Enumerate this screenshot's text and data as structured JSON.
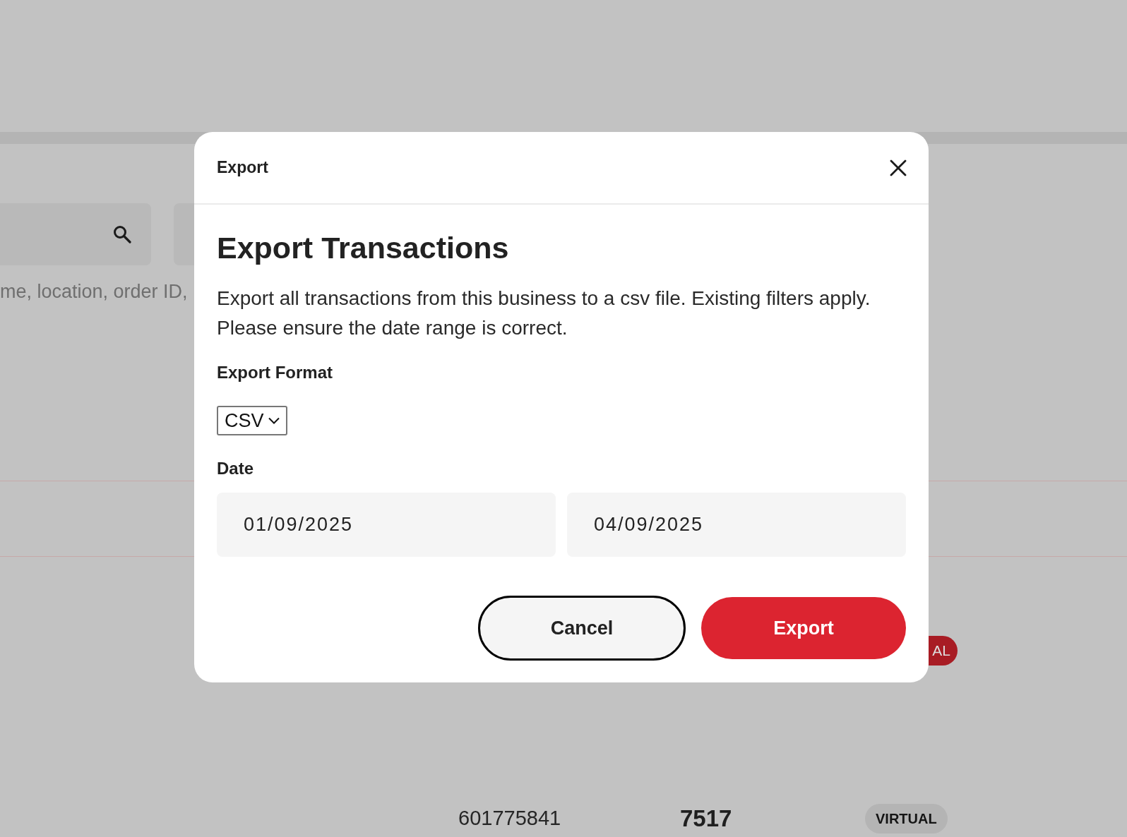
{
  "page": {
    "search_field": {
      "hint": "me, location, order ID,"
    },
    "badge": {
      "label": "AL"
    },
    "row": {
      "column_1": "601775841",
      "column_2": "7517",
      "badge": "VIRTUAL"
    }
  },
  "dialog": {
    "header_title": "Export",
    "title": "Export Transactions",
    "description": "Export all transactions from this business to a csv file. Existing filters apply. Please ensure the date range is correct.",
    "format": {
      "label": "Export Format",
      "value": "CSV"
    },
    "date": {
      "label": "Date",
      "start": "01/09/2025",
      "end": "04/09/2025"
    },
    "buttons": [
      {
        "label": "Cancel",
        "kind": "secondary"
      },
      {
        "label": "Export",
        "kind": "primary"
      }
    ]
  }
}
